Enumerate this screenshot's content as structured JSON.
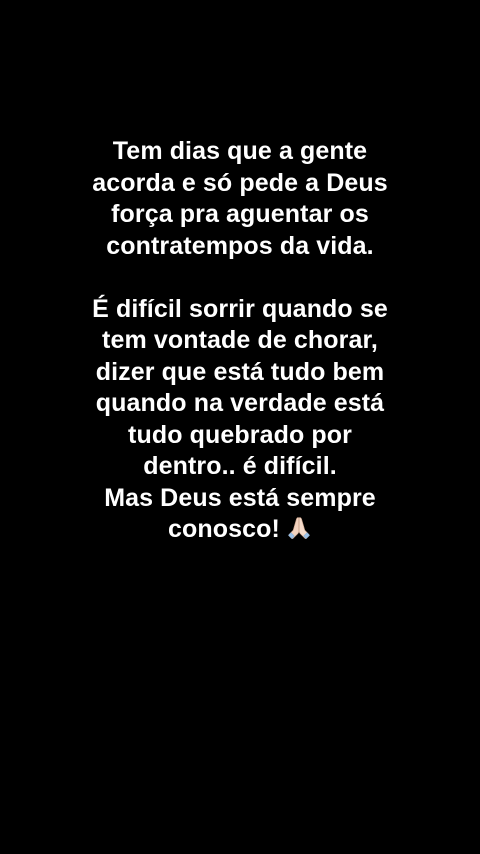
{
  "story": {
    "paragraph1": [
      "Tem dias que a gente",
      "acorda e só pede a Deus",
      "força pra aguentar os",
      "contratempos da vida."
    ],
    "paragraph2": [
      "É difícil sorrir quando se",
      "tem vontade de chorar,",
      "dizer que está tudo bem",
      "quando na verdade está",
      "tudo quebrado por",
      "dentro.. é difícil.",
      "Mas Deus está sempre",
      "conosco!"
    ],
    "emoji_icon": "praying-hands-icon",
    "text_color": "#ffffff",
    "background_color": "#000000"
  }
}
